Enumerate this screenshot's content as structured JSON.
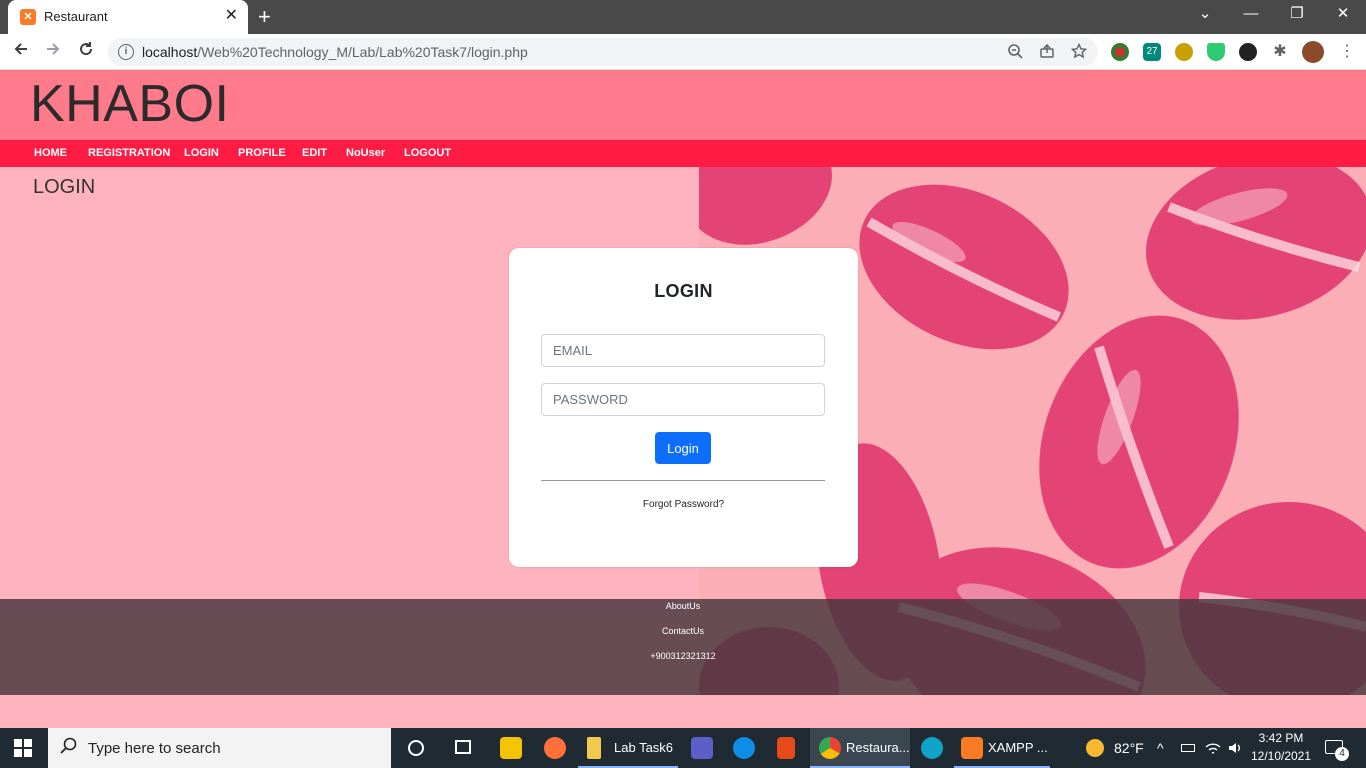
{
  "browser": {
    "tab_title": "Restaurant",
    "tab_close": "✕",
    "new_tab": "+",
    "url_host": "localhost",
    "url_path": "/Web%20Technology_M/Lab/Lab%20Task7/login.php",
    "window_controls": [
      "⌄",
      "—",
      "❐",
      "✕"
    ]
  },
  "site": {
    "logo": "KHABOI",
    "nav": [
      "HOME",
      "REGISTRATION",
      "LOGIN",
      "PROFILE",
      "EDIT",
      "NoUser",
      "LOGOUT"
    ],
    "page_heading": "LOGIN"
  },
  "login_form": {
    "title": "LOGIN",
    "email_placeholder": "EMAIL",
    "password_placeholder": "PASSWORD",
    "submit_label": "Login",
    "forgot_label": "Forgot Password?",
    "accent_color": "#0d6efd"
  },
  "footer": {
    "links": [
      "AboutUs",
      "ContactUs",
      "+900312321312"
    ]
  },
  "taskbar": {
    "search_placeholder": "Type here to search",
    "apps": [
      {
        "label": "Lab Task6",
        "icon": "folder-icon"
      },
      {
        "label": "Restaura...",
        "icon": "chrome-icon"
      },
      {
        "label": "XAMPP ...",
        "icon": "xampp-icon"
      }
    ],
    "weather": "82°F",
    "time": "3:42 PM",
    "date": "12/10/2021",
    "notification_count": "4"
  },
  "colors": {
    "header": "#ff7b8c",
    "navbar": "#ff1c44",
    "page_bg": "#ffb3be"
  }
}
